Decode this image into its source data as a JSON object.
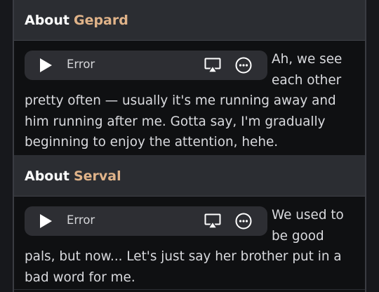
{
  "sections": [
    {
      "title_prefix": "About",
      "name": "Gepard",
      "player": {
        "status": "Error"
      },
      "text": "Ah, we see each other pretty often — usually it's me running away and him running after me. Gotta say, I'm gradually beginning to enjoy the attention, hehe."
    },
    {
      "title_prefix": "About",
      "name": "Serval",
      "player": {
        "status": "Error"
      },
      "text": "We used to be good pals, but now... Let's just say her brother put in a bad word for me."
    }
  ],
  "colors": {
    "name_accent": "#e0b389",
    "header_bg": "#2b2d32",
    "content_bg": "#0f1012",
    "player_bg": "#2d2e33"
  },
  "icons": [
    "play-icon",
    "airplay-icon",
    "more-options-icon"
  ]
}
